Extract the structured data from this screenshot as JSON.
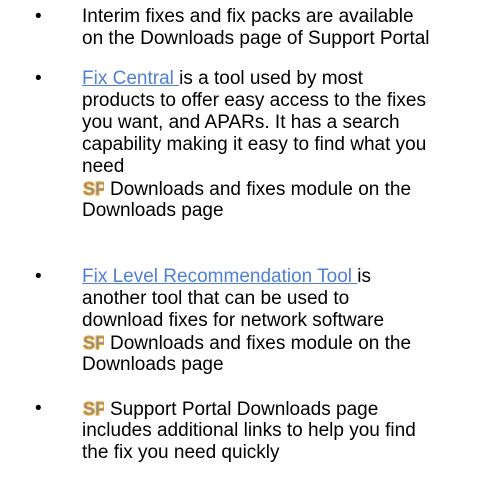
{
  "items": [
    {
      "lines": [
        "Interim fixes and fix packs are available",
        "on the Downloads page of Support Portal"
      ]
    },
    {
      "link": "Fix Central ",
      "line1_rest": "is a tool used by most",
      "lines": [
        "products to offer easy access to the fixes",
        "you want, and APARs. It has a search",
        "capability making it easy to find what you",
        "need"
      ],
      "sp_line": "Downloads and fixes module on the",
      "sp_line_end": "Downloads page"
    },
    {
      "link": "Fix Level Recommendation Tool ",
      "line1_rest": "is",
      "lines": [
        "another tool that can be used to",
        "download fixes for network software"
      ],
      "sp_line": "Downloads and fixes module on the",
      "sp_line_end": "Downloads page"
    },
    {
      "sp_line": "Support Portal Downloads page",
      "lines": [
        "includes additional links to help you find",
        "the fix you need quickly"
      ]
    }
  ],
  "bullet_char": "•",
  "icon_name": "support-portal-icon",
  "colors": {
    "link": "#4f7fd6",
    "icon_fill": "#5b8fd8",
    "icon_outline": "#f0a020"
  }
}
